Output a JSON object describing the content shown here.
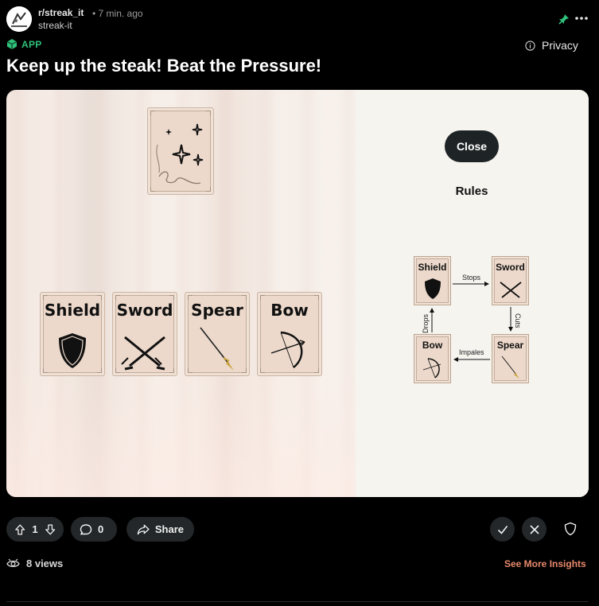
{
  "header": {
    "subreddit": "r/streak_it",
    "time": "• 7 min. ago",
    "author": "streak-it",
    "app_badge": "APP",
    "privacy_label": "Privacy",
    "pin_icon": "pin-icon",
    "more_icon": "more-icon"
  },
  "post": {
    "title": "Keep up the steak! Beat the Pressure!"
  },
  "game": {
    "cards": [
      {
        "label": "Shield",
        "icon": "shield-icon"
      },
      {
        "label": "Sword",
        "icon": "crossed-swords-icon"
      },
      {
        "label": "Spear",
        "icon": "spear-icon"
      },
      {
        "label": "Bow",
        "icon": "bow-icon"
      }
    ],
    "deck_icon": "sparkles-icon",
    "close_label": "Close",
    "rules_title": "Rules",
    "rules": {
      "cards": [
        "Shield",
        "Sword",
        "Bow",
        "Spear"
      ],
      "stops": "Stops",
      "cuts": "Cuts",
      "impales": "Impales",
      "drops": "Drops"
    }
  },
  "actions": {
    "vote_count": "1",
    "comment_count": "0",
    "share_label": "Share"
  },
  "footer": {
    "views": "8 views",
    "insights_label": "See More Insights"
  },
  "colors": {
    "accent_green": "#2fc07a",
    "insights_orange": "#e8896c",
    "pin_green": "#2fc07a"
  }
}
